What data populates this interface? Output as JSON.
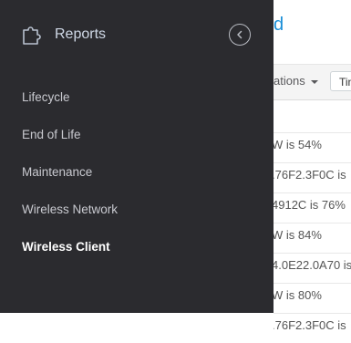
{
  "background": {
    "title_fragment": "d",
    "dropdown_fragment": "ations",
    "chip_fragment": "Tin",
    "rows": [
      "W is 54%",
      ".76F2.3F0C is",
      "4912C is 76%",
      "W is 84%",
      "4.0E22.0A70 is",
      "W is 80%",
      ".76F2.3F0C is"
    ]
  },
  "drawer": {
    "header": {
      "icon": "puzzle-icon",
      "title": "Reports",
      "collapse_icon": "chevron-left-icon"
    },
    "nav": [
      {
        "label": "Lifecycle",
        "active": false
      },
      {
        "label": "End of Life",
        "active": false
      },
      {
        "label": "Maintenance",
        "active": false
      },
      {
        "label": "Wireless Network",
        "active": false
      },
      {
        "label": "Wireless Client",
        "active": true
      }
    ]
  },
  "colors": {
    "drawer_bg": "#2b2b2f",
    "accent_blue": "#1a8fd8",
    "active_text": "#ffffff",
    "nav_text": "#c9cad0"
  }
}
